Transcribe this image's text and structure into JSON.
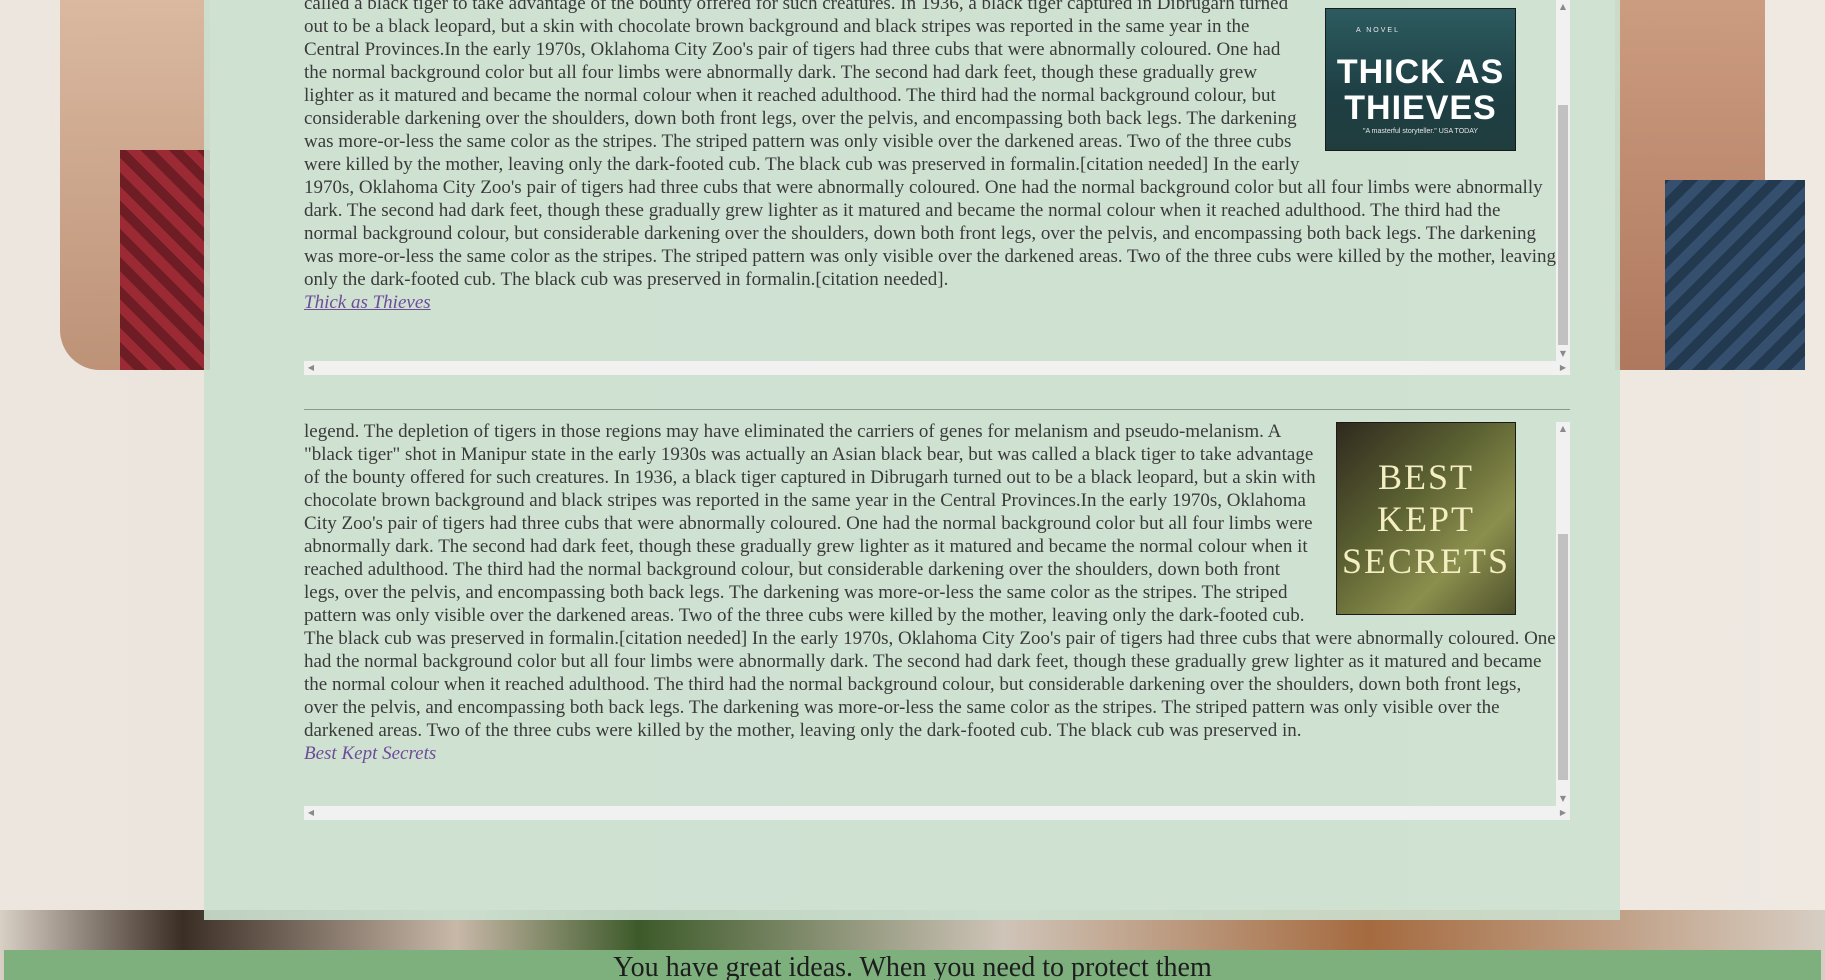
{
  "posts": [
    {
      "body": "called a black tiger to take advantage of the bounty offered for such creatures. In 1936, a black tiger captured in Dibrugarh turned out to be a black leopard, but a skin with chocolate brown background and black stripes was reported in the same year in the Central Provinces.In the early 1970s, Oklahoma City Zoo's pair of tigers had three cubs that were abnormally coloured. One had the normal background color but all four limbs were abnormally dark. The second had dark feet, though these gradually grew lighter as it matured and became the normal colour when it reached adulthood. The third had the normal background colour, but considerable darkening over the shoulders, down both front legs, over the pelvis, and encompassing both back legs. The darkening was more-or-less the same color as the stripes. The striped pattern was only visible over the darkened areas. Two of the three cubs were killed by the mother, leaving only the dark-footed cub. The black cub was preserved in formalin.[citation needed] In the early 1970s, Oklahoma City Zoo's pair of tigers had three cubs that were abnormally coloured. One had the normal background color but all four limbs were abnormally dark. The second had dark feet, though these gradually grew lighter as it matured and became the normal colour when it reached adulthood. The third had the normal background colour, but considerable darkening over the shoulders, down both front legs, over the pelvis, and encompassing both back legs. The darkening was more-or-less the same color as the stripes. The striped pattern was only visible over the darkened areas. Two of the three cubs were killed by the mother, leaving only the dark-footed cub. The black cub was preserved in formalin.[citation needed].",
      "link": "Thick as Thieves",
      "cover": {
        "kicker": "A NOVEL",
        "title_line1": "THICK AS",
        "title_line2": "THIEVES",
        "blurb": "\"A masterful storyteller.\" USA TODAY"
      }
    },
    {
      "body": "legend. The depletion of tigers in those regions may have eliminated the carriers of genes for melanism and pseudo-melanism. A \"black tiger\" shot in Manipur state in the early 1930s was actually an Asian black bear, but was called a black tiger to take advantage of the bounty offered for such creatures. In 1936, a black tiger captured in Dibrugarh turned out to be a black leopard, but a skin with chocolate brown background and black stripes was reported in the same year in the Central Provinces.In the early 1970s, Oklahoma City Zoo's pair of tigers had three cubs that were abnormally coloured. One had the normal background color but all four limbs were abnormally dark. The second had dark feet, though these gradually grew lighter as it matured and became the normal colour when it reached adulthood. The third had the normal background colour, but considerable darkening over the shoulders, down both front legs, over the pelvis, and encompassing both back legs. The darkening was more-or-less the same color as the stripes. The striped pattern was only visible over the darkened areas. Two of the three cubs were killed by the mother, leaving only the dark-footed cub. The black cub was preserved in formalin.[citation needed] In the early 1970s, Oklahoma City Zoo's pair of tigers had three cubs that were abnormally coloured. One had the normal background color but all four limbs were abnormally dark. The second had dark feet, though these gradually grew lighter as it matured and became the normal colour when it reached adulthood. The third had the normal background colour, but considerable darkening over the shoulders, down both front legs, over the pelvis, and encompassing both back legs. The darkening was more-or-less the same color as the stripes. The striped pattern was only visible over the darkened areas. Two of the three cubs were killed by the mother, leaving only the dark-footed cub. The black cub was preserved in.",
      "link": "Best Kept Secrets",
      "cover": {
        "title_line1": "BEST",
        "title_line2": "KEPT",
        "title_line3": "SECRETS"
      }
    }
  ],
  "scroll_icons": {
    "up": "▲",
    "down": "▼",
    "left": "◀",
    "right": "▶"
  },
  "banner": {
    "text": "You have great ideas. When you need to protect them"
  },
  "colors": {
    "panel": "#cce1d0",
    "banner": "#7eb07e",
    "link": "#6e4c9a"
  }
}
